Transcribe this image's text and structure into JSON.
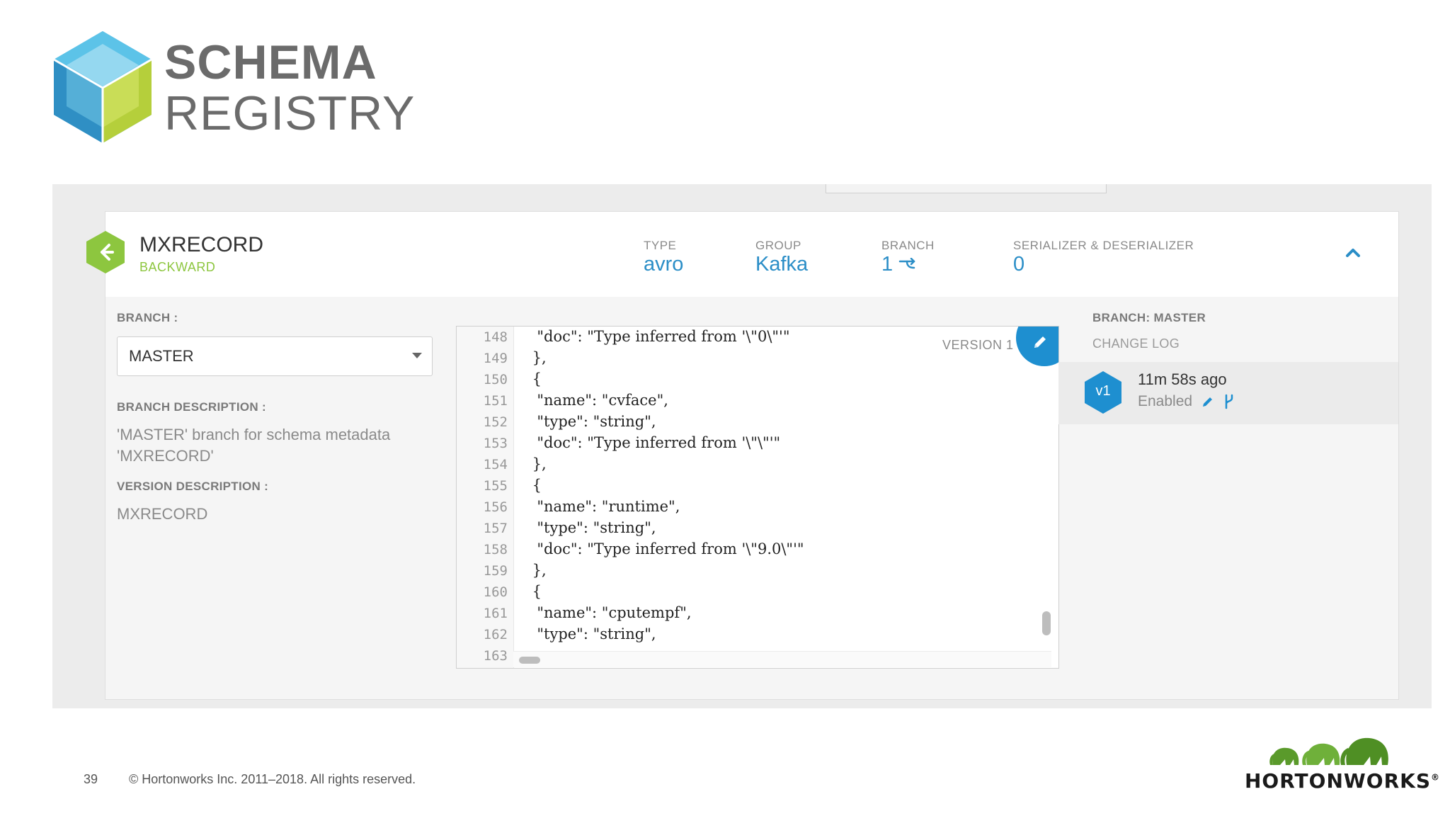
{
  "slide": {
    "logo_line1": "SCHEMA",
    "logo_line2": "REGISTRY",
    "page_number": "39",
    "copyright": "© Hortonworks Inc. 2011–2018. All rights reserved.",
    "footer_logo_text": "HORTONWORKS",
    "footer_logo_mark": "®"
  },
  "schema": {
    "name": "MXRECORD",
    "compatibility": "BACKWARD",
    "type_label": "TYPE",
    "type_value": "avro",
    "group_label": "GROUP",
    "group_value": "Kafka",
    "branch_label": "BRANCH",
    "branch_value": "1",
    "serdes_label": "SERIALIZER & DESERIALIZER",
    "serdes_value": "0"
  },
  "left_panel": {
    "branch_label": "BRANCH :",
    "branch_selected": "MASTER",
    "branch_desc_label": "BRANCH DESCRIPTION :",
    "branch_desc_line1": "'MASTER' branch for schema metadata",
    "branch_desc_line2": "'MXRECORD'",
    "version_desc_label": "VERSION DESCRIPTION :",
    "version_desc": "MXRECORD"
  },
  "editor": {
    "version_label": "VERSION 1",
    "line_numbers": [
      "148",
      "149",
      "150",
      "151",
      "152",
      "153",
      "154",
      "155",
      "156",
      "157",
      "158",
      "159",
      "160",
      "161",
      "162",
      "163"
    ],
    "lines": [
      "  \"doc\": \"Type inferred from '\\\"0\\\"'\"",
      " },",
      " {",
      "  \"name\": \"cvface\",",
      "  \"type\": \"string\",",
      "  \"doc\": \"Type inferred from '\\\"\\\"'\"",
      " },",
      " {",
      "  \"name\": \"runtime\",",
      "  \"type\": \"string\",",
      "  \"doc\": \"Type inferred from '\\\"9.0\\\"'\"",
      " },",
      " {",
      "  \"name\": \"cputempf\",",
      "  \"type\": \"string\",",
      ""
    ]
  },
  "right_panel": {
    "branch_title": "BRANCH: MASTER",
    "changelog_label": "CHANGE LOG",
    "version_badge": "v1",
    "version_time": "11m 58s ago",
    "version_status": "Enabled"
  },
  "colors": {
    "accent_blue": "#1e8fd0",
    "compat_green": "#8dc63f",
    "frame_gray": "#ececec"
  },
  "icons": {
    "schema_badge": "arrow-left-hexagon-icon",
    "collapse": "chevron-up-icon",
    "edit": "pencil-icon",
    "fork": "fork-icon"
  }
}
